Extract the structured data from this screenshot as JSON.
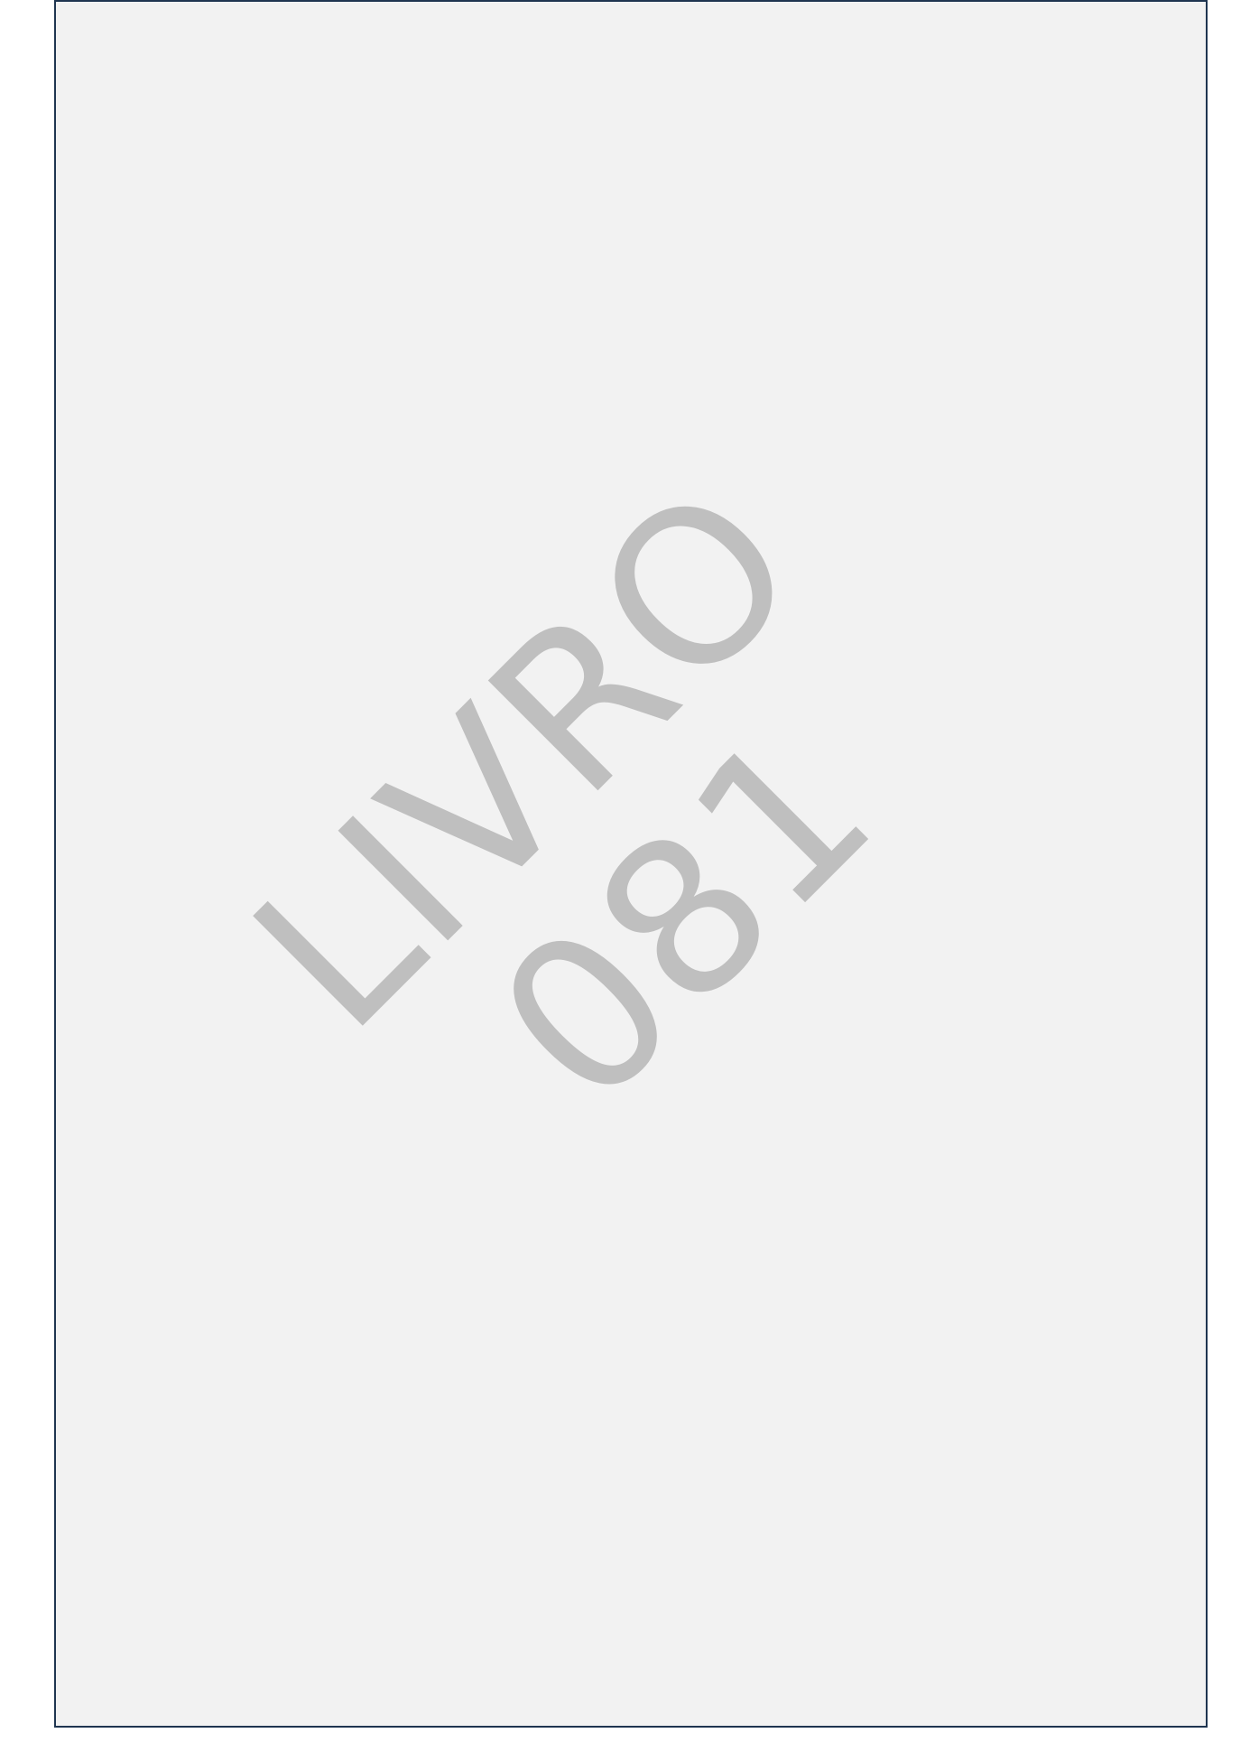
{
  "cover": {
    "line1": "LIVRO",
    "line2": "081",
    "colors": {
      "background": "#f2f2f2",
      "border": "#1f3550",
      "text": "#bfbfbf"
    }
  }
}
